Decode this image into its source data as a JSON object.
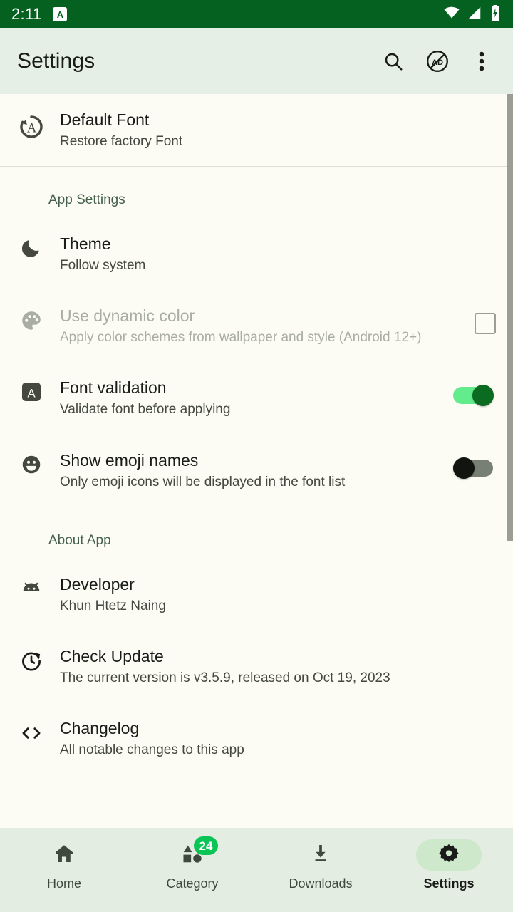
{
  "status_bar": {
    "time": "2:11",
    "notification_icon": "font-app-notification-icon",
    "notification_letter": "A",
    "icons": [
      "wifi-icon",
      "cellular-signal-icon",
      "battery-charging-icon"
    ],
    "background_color": "#04611F"
  },
  "app_bar": {
    "title": "Settings",
    "actions": [
      {
        "name": "search-icon",
        "label": "Search"
      },
      {
        "name": "ad-block-icon",
        "label": "AD"
      },
      {
        "name": "overflow-menu-icon",
        "label": "More options"
      }
    ],
    "background_color": "#E6EFE6"
  },
  "content": {
    "default_font": {
      "icon": "restore-font-icon",
      "title": "Default Font",
      "subtitle": "Restore factory Font"
    },
    "app_settings": {
      "header": "App Settings",
      "items": [
        {
          "icon": "moon-icon",
          "title": "Theme",
          "subtitle": "Follow system",
          "control": "none",
          "enabled": true
        },
        {
          "icon": "palette-icon",
          "title": "Use dynamic color",
          "subtitle": "Apply color schemes from wallpaper and style (Android 12+)",
          "control": "checkbox",
          "checked": false,
          "enabled": false
        },
        {
          "icon": "letter-a-box-icon",
          "title": "Font validation",
          "subtitle": "Validate font before applying",
          "control": "switch",
          "checked": true,
          "enabled": true
        },
        {
          "icon": "emoji-face-icon",
          "title": "Show emoji names",
          "subtitle": "Only emoji icons will be displayed in the font list",
          "control": "switch",
          "checked": false,
          "enabled": true
        }
      ]
    },
    "about_app": {
      "header": "About App",
      "items": [
        {
          "icon": "android-head-icon",
          "title": "Developer",
          "subtitle": "Khun Htetz Naing"
        },
        {
          "icon": "update-clock-icon",
          "title": "Check Update",
          "subtitle": "The current version is v3.5.9, released on Oct 19, 2023"
        },
        {
          "icon": "code-brackets-icon",
          "title": "Changelog",
          "subtitle": "All notable changes to this app"
        }
      ]
    }
  },
  "bottom_nav": {
    "items": [
      {
        "icon": "home-icon",
        "label": "Home",
        "active": false,
        "badge": null
      },
      {
        "icon": "category-shapes-icon",
        "label": "Category",
        "active": false,
        "badge": "24"
      },
      {
        "icon": "download-icon",
        "label": "Downloads",
        "active": false,
        "badge": null
      },
      {
        "icon": "gear-icon",
        "label": "Settings",
        "active": true,
        "badge": null
      }
    ],
    "badge_color": "#0BC456",
    "active_pill_color": "#CDE8CB"
  }
}
